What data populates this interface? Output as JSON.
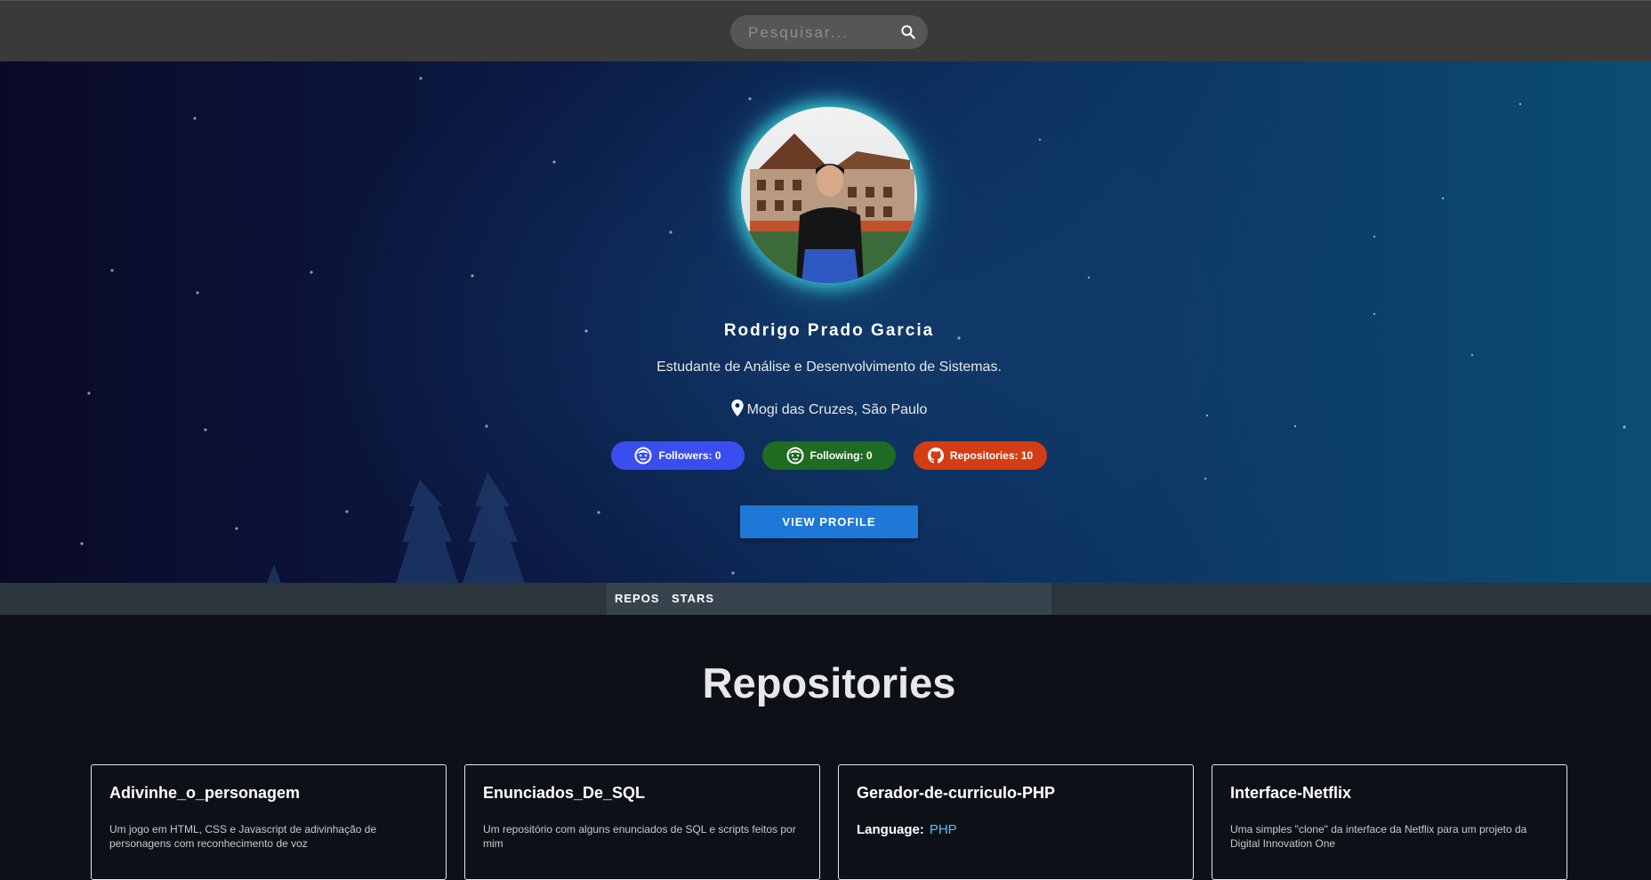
{
  "search": {
    "placeholder": "Pesquisar...",
    "icon": "search-icon"
  },
  "profile": {
    "name": "Rodrigo Prado Garcia",
    "bio": "Estudante de Análise e Desenvolvimento de Sistemas.",
    "location": "Mogi das Cruzes, São Paulo",
    "stats": {
      "followers": "Followers: 0",
      "following": "Following: 0",
      "repositories": "Repositories: 10"
    },
    "view_profile_label": "VIEW PROFILE"
  },
  "tabs": [
    "REPOS",
    "STARS"
  ],
  "repositories": {
    "title": "Repositories",
    "cards": [
      {
        "name": "Adivinhe_o_personagem",
        "description": "Um jogo em HTML, CSS e Javascript de adivinhação de personagens com reconhecimento de voz"
      },
      {
        "name": "Enunciados_De_SQL",
        "description": "Um repositório com alguns enunciados de SQL e scripts feitos por mim"
      },
      {
        "name": "Gerador-de-curriculo-PHP",
        "language_label": "Language:",
        "language": "PHP"
      },
      {
        "name": "Interface-Netflix",
        "description": "Uma simples \"clone\" da interface da Netflix para um projeto da Digital Innovation One"
      }
    ]
  },
  "colors": {
    "topbar": "#3a3a3a",
    "followers_pill": "#3a4ef0",
    "following_pill": "#1f6b22",
    "repositories_pill": "#d43d14",
    "view_profile_button": "#1e78d6",
    "avatar_glow": "#40e0e6",
    "language_value": "#4fc3f7"
  }
}
